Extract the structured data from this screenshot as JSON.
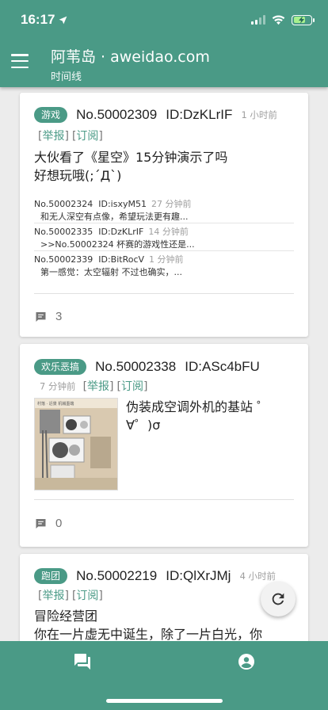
{
  "status": {
    "time": "16:17",
    "battery_color": "#a7f08e"
  },
  "header": {
    "title": "阿苇岛 · aweidao.com",
    "subtitle": "时间线",
    "color": "#4a9a86"
  },
  "posts": [
    {
      "tag": "游戏",
      "no": "No.50002309",
      "id": "ID:DzKLrIF",
      "time": "1 小时前",
      "report": "举报",
      "subscribe": "订阅",
      "text_lines": [
        "大伙看了《星空》15分钟演示了吗",
        "好想玩哦(;´Д`)"
      ],
      "replies": [
        {
          "no": "No.50002324",
          "id": "ID:isxyM51",
          "time": "27 分钟前",
          "text": "和无人深空有点像，希望玩法更有趣..."
        },
        {
          "no": "No.50002335",
          "id": "ID:DzKLrIF",
          "time": "14 分钟前",
          "text": ">>No.50002324 杯赛的游戏性还是..."
        },
        {
          "no": "No.50002339",
          "id": "ID:BitRocV",
          "time": "1 分钟前",
          "text": "第一感觉：太空辐射 不过也确实，..."
        }
      ],
      "comments": "3"
    },
    {
      "tag": "欢乐恶搞",
      "no": "No.50002338",
      "id": "ID:ASc4bFU",
      "time": "7 分钟前",
      "report": "举报",
      "subscribe": "订阅",
      "text_lines": [
        "伪装成空调外机的基站 ゜",
        "∀゜)σ"
      ],
      "image_caption": "村落 · 近景 机械墨端",
      "comments": "0"
    },
    {
      "tag": "跑团",
      "no": "No.50002219",
      "id": "ID:QlXrJMj",
      "time": "4 小时前",
      "report": "举报",
      "subscribe": "订阅",
      "text_lines": [
        "冒险经营团",
        "你在一片虚无中诞生，除了一片白光，你"
      ]
    }
  ],
  "nav": {
    "left_icon": "forum-icon",
    "right_icon": "account-circle-icon"
  }
}
